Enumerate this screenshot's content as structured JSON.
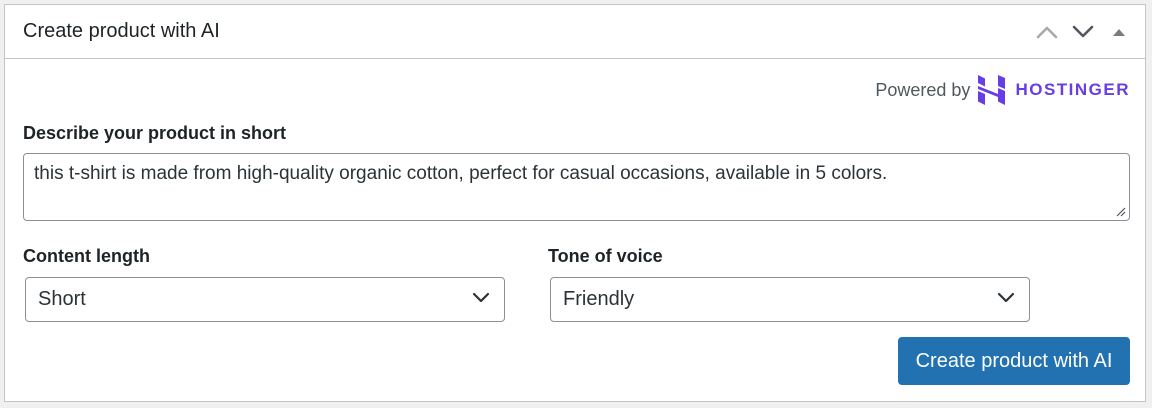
{
  "panel": {
    "title": "Create product with AI",
    "controls": [
      {
        "name": "move-up-icon"
      },
      {
        "name": "move-down-icon"
      },
      {
        "name": "collapse-toggle-icon"
      }
    ]
  },
  "powered_by": {
    "prefix": "Powered by",
    "brand": "HOSTINGER",
    "brand_color": "#673de6"
  },
  "description": {
    "label": "Describe your product in short",
    "value": "this t-shirt is made from high-quality organic cotton, perfect for casual occasions, available in 5 colors."
  },
  "content_length": {
    "label": "Content length",
    "selected": "Short"
  },
  "tone_of_voice": {
    "label": "Tone of voice",
    "selected": "Friendly"
  },
  "submit": {
    "label": "Create product with AI",
    "color": "#2271b1"
  }
}
